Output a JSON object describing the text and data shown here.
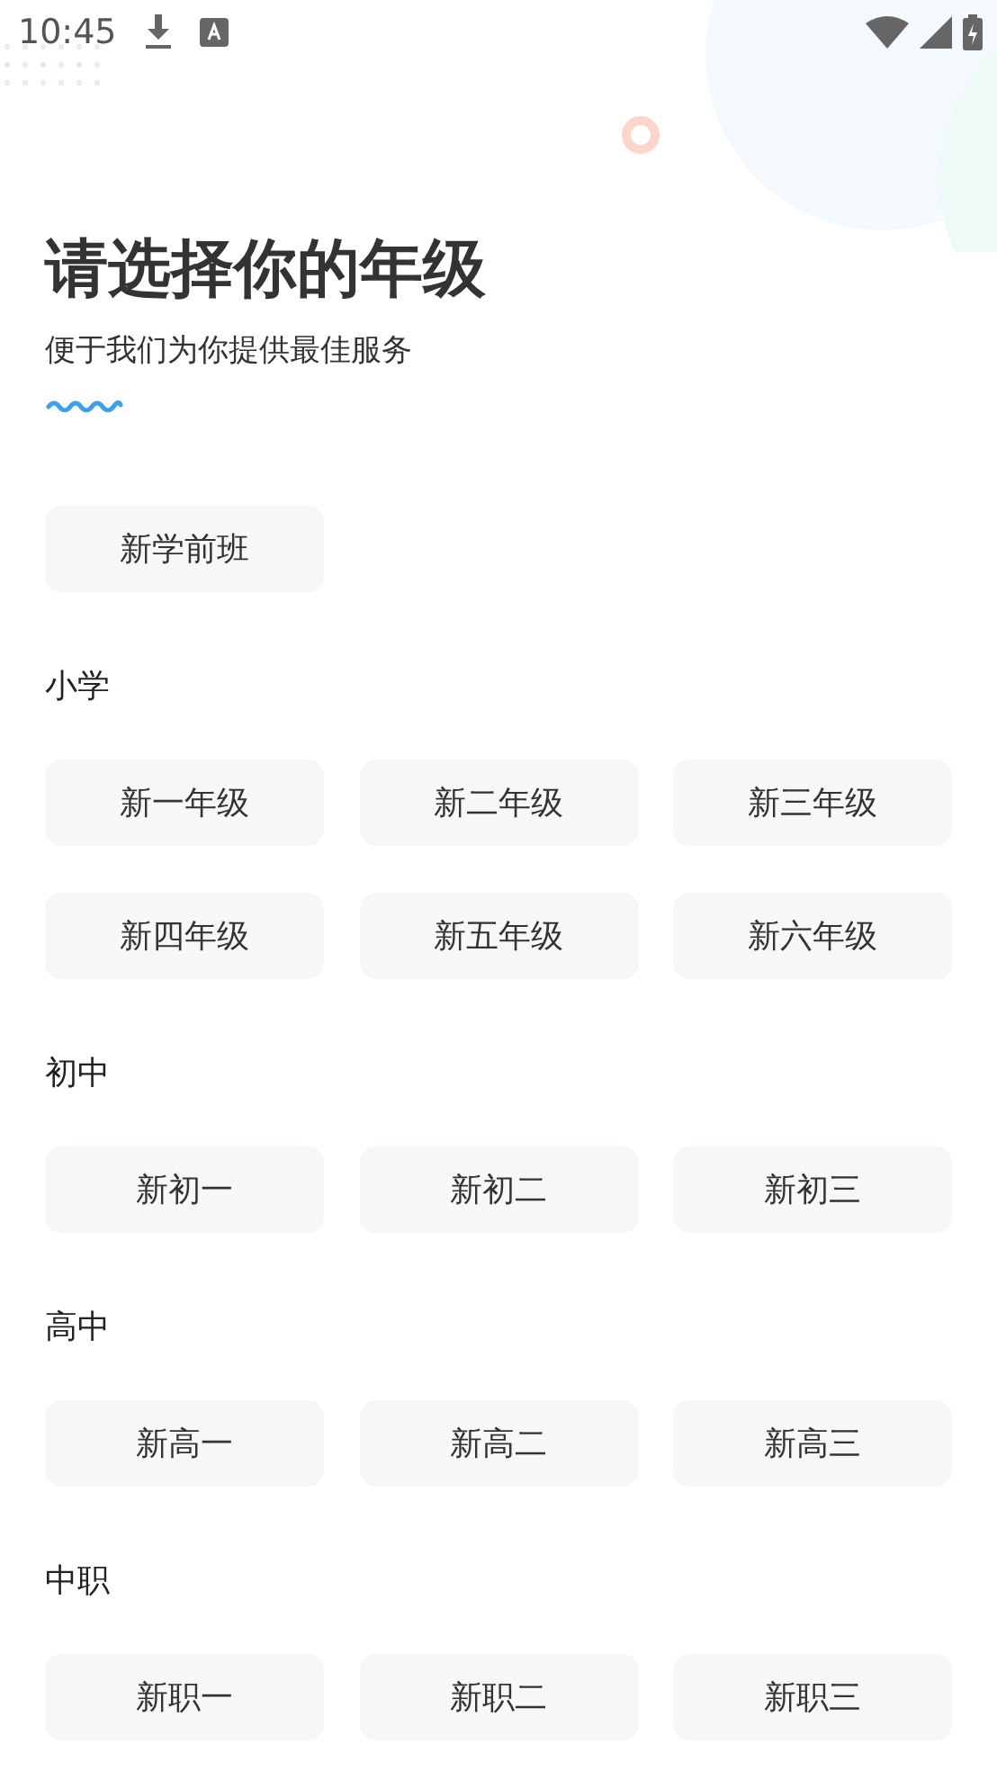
{
  "status_bar": {
    "time": "10:45"
  },
  "title": "请选择你的年级",
  "subtitle": "便于我们为你提供最佳服务",
  "groups": [
    {
      "options": [
        "新学前班"
      ]
    },
    {
      "heading": "小学",
      "options": [
        "新一年级",
        "新二年级",
        "新三年级",
        "新四年级",
        "新五年级",
        "新六年级"
      ]
    },
    {
      "heading": "初中",
      "options": [
        "新初一",
        "新初二",
        "新初三"
      ]
    },
    {
      "heading": "高中",
      "options": [
        "新高一",
        "新高二",
        "新高三"
      ]
    },
    {
      "heading": "中职",
      "options": [
        "新职一",
        "新职二",
        "新职三"
      ]
    }
  ]
}
